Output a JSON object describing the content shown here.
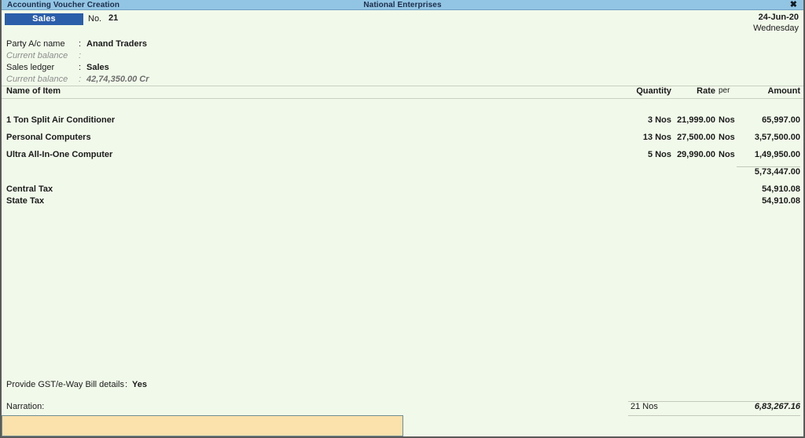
{
  "titlebar": {
    "left_title": "Accounting Voucher Creation",
    "company": "National Enterprises",
    "close_glyph": "✖"
  },
  "voucher": {
    "type_badge": "Sales",
    "number_label": "No.",
    "number_value": "21",
    "date": "24-Jun-20",
    "day": "Wednesday"
  },
  "party": {
    "party_label": "Party A/c name",
    "party_colon": ":",
    "party_value": "Anand Traders",
    "party_balance_label": "Current balance",
    "party_balance_colon": ":",
    "party_balance_value": "",
    "ledger_label": "Sales ledger",
    "ledger_colon": ":",
    "ledger_value": "Sales",
    "ledger_balance_label": "Current balance",
    "ledger_balance_colon": ":",
    "ledger_balance_value": "42,74,350.00 Cr"
  },
  "table": {
    "headers": {
      "item": "Name of Item",
      "quantity": "Quantity",
      "rate": "Rate",
      "per": "per",
      "amount": "Amount"
    },
    "rows": [
      {
        "name": "1 Ton Split Air Conditioner",
        "quantity": "3 Nos",
        "rate": "21,999.00",
        "per": "Nos",
        "amount": "65,997.00"
      },
      {
        "name": "Personal Computers",
        "quantity": "13 Nos",
        "rate": "27,500.00",
        "per": "Nos",
        "amount": "3,57,500.00"
      },
      {
        "name": "Ultra All-In-One Computer",
        "quantity": "5 Nos",
        "rate": "29,990.00",
        "per": "Nos",
        "amount": "1,49,950.00"
      }
    ],
    "subtotal": "5,73,447.00",
    "taxes": [
      {
        "name": "Central Tax",
        "amount": "54,910.08"
      },
      {
        "name": "State Tax",
        "amount": "54,910.08"
      }
    ]
  },
  "gst": {
    "label": "Provide GST/e-Way Bill details",
    "colon": ":",
    "value": "Yes"
  },
  "narration": {
    "label": "Narration:",
    "value": "",
    "placeholder": ""
  },
  "totals": {
    "quantity": "21 Nos",
    "amount": "6,83,267.16"
  },
  "colors": {
    "titlebar": "#92c5e4",
    "badge": "#2b5eaa",
    "background": "#f1faea",
    "input": "#fbe1ab"
  }
}
